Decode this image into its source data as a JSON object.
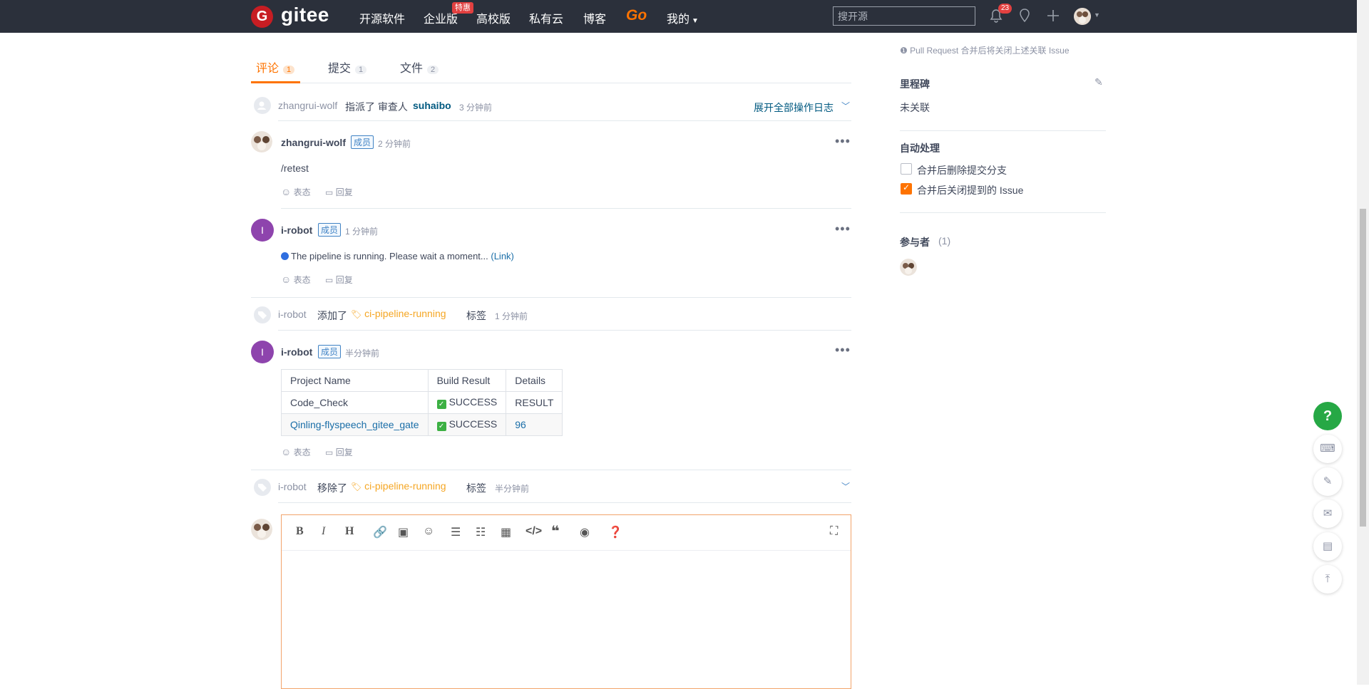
{
  "nav": {
    "logo_letter": "G",
    "logo_text": "gitee",
    "items": [
      "开源软件",
      "企业版",
      "高校版",
      "私有云",
      "博客"
    ],
    "go_label": "Go",
    "mine_label": "我的",
    "hot_badge": "特惠",
    "search_placeholder": "搜开源",
    "notification_count": "23"
  },
  "tabs": [
    {
      "label": "评论",
      "count": "1"
    },
    {
      "label": "提交",
      "count": "1"
    },
    {
      "label": "文件",
      "count": "2"
    }
  ],
  "event_assign": {
    "user": "zhangrui-wolf",
    "verb": "指派了 审查人",
    "target": "suhaibo",
    "time": "3 分钟前",
    "expand_label": "展开全部操作日志"
  },
  "comments": [
    {
      "user": "zhangrui-wolf",
      "badge": "成员",
      "time": "2 分钟前",
      "body": "/retest",
      "react_label": "表态",
      "reply_label": "回复"
    },
    {
      "avatar_letter": "I",
      "user": "i-robot",
      "badge": "成员",
      "time": "1 分钟前",
      "body": "The pipeline is running. Please wait a moment... ",
      "link": "(Link)",
      "react_label": "表态",
      "reply_label": "回复"
    },
    {
      "avatar_letter": "I",
      "user": "i-robot",
      "badge": "成员",
      "time": "半分钟前",
      "react_label": "表态",
      "reply_label": "回复",
      "table": {
        "headers": [
          "Project Name",
          "Build Result",
          "Details"
        ],
        "rows": [
          [
            "Code_Check",
            "SUCCESS",
            "RESULT"
          ],
          [
            "Qinling-flyspeech_gitee_gate",
            "SUCCESS",
            "96"
          ]
        ]
      }
    }
  ],
  "label_events": [
    {
      "user": "i-robot",
      "verb": "添加了",
      "label": "ci-pipeline-running",
      "suffix": "标签",
      "time": "1 分钟前"
    },
    {
      "user": "i-robot",
      "verb": "移除了",
      "label": "ci-pipeline-running",
      "suffix": "标签",
      "time": "半分钟前"
    }
  ],
  "sidebar": {
    "pr_note": "Pull Request 合并后将关闭上述关联 Issue",
    "milestone_title": "里程碑",
    "milestone_value": "未关联",
    "auto_title": "自动处理",
    "option1": "合并后删除提交分支",
    "option2": "合并后关闭提到的 Issue",
    "participants_title": "参与者",
    "participants_count": "(1)"
  },
  "float": {
    "help": "?"
  }
}
